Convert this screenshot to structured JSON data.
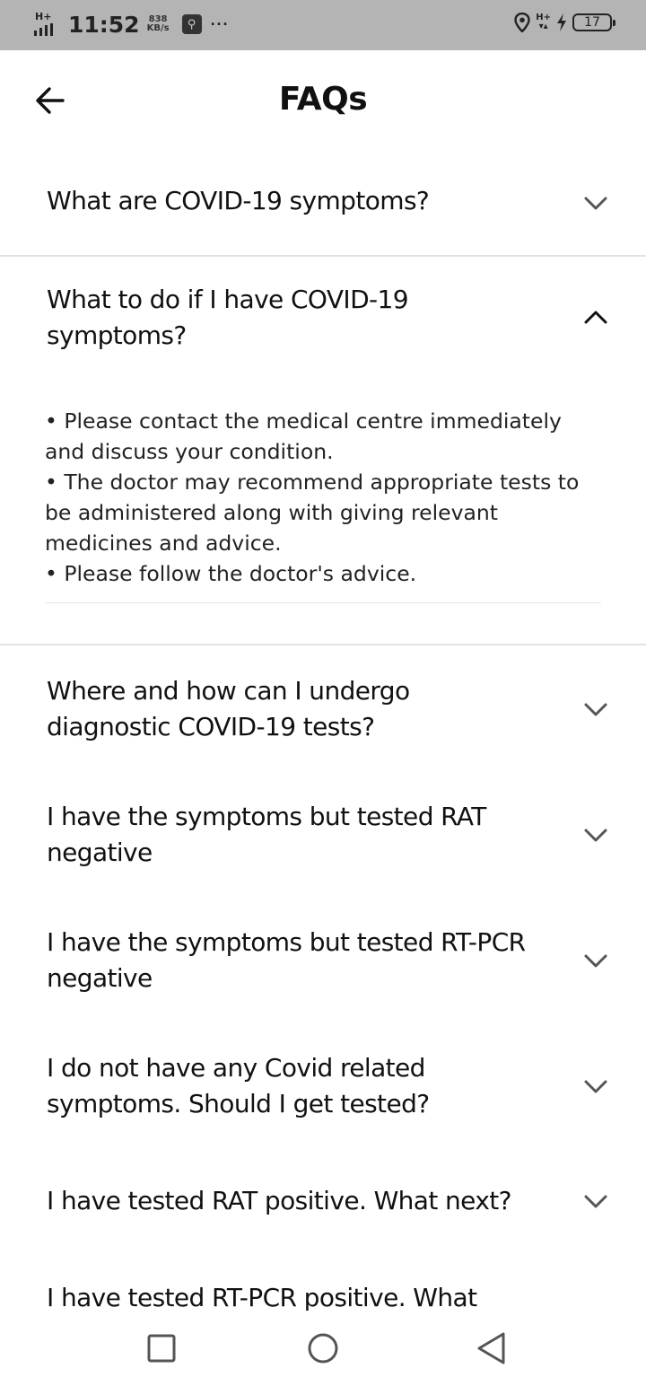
{
  "status_bar": {
    "network_type": "H+",
    "time": "11:52",
    "speed_value": "838",
    "speed_unit": "KB/s",
    "usb_icon": "usb-debug-icon",
    "more": "···",
    "right_network": "H+",
    "battery_level": "17"
  },
  "header": {
    "title": "FAQs",
    "back_icon": "arrow-left-icon"
  },
  "faqs": [
    {
      "question": "What are COVID-19 symptoms?",
      "expanded": false
    },
    {
      "question": "What to do if I have COVID-19 symptoms?",
      "expanded": true,
      "answer": [
        "• Please contact the medical centre immediately and discuss your condition.",
        "• The doctor may recommend appropriate tests to be administered along with giving relevant medicines and advice.",
        "• Please follow the doctor's advice."
      ]
    },
    {
      "question": "Where and how can I undergo diagnostic COVID-19 tests?",
      "expanded": false
    },
    {
      "question": "I have the symptoms but tested RAT negative",
      "expanded": false
    },
    {
      "question": "I have the symptoms but tested RT-PCR negative",
      "expanded": false
    },
    {
      "question": "I do not have any Covid related symptoms. Should I get tested?",
      "expanded": false
    },
    {
      "question": "I have tested RAT positive. What next?",
      "expanded": false
    },
    {
      "question": "I have tested RT-PCR positive. What",
      "expanded": false
    }
  ],
  "nav": {
    "recents_icon": "square-recents-icon",
    "home_icon": "circle-home-icon",
    "back_icon": "triangle-back-icon"
  }
}
